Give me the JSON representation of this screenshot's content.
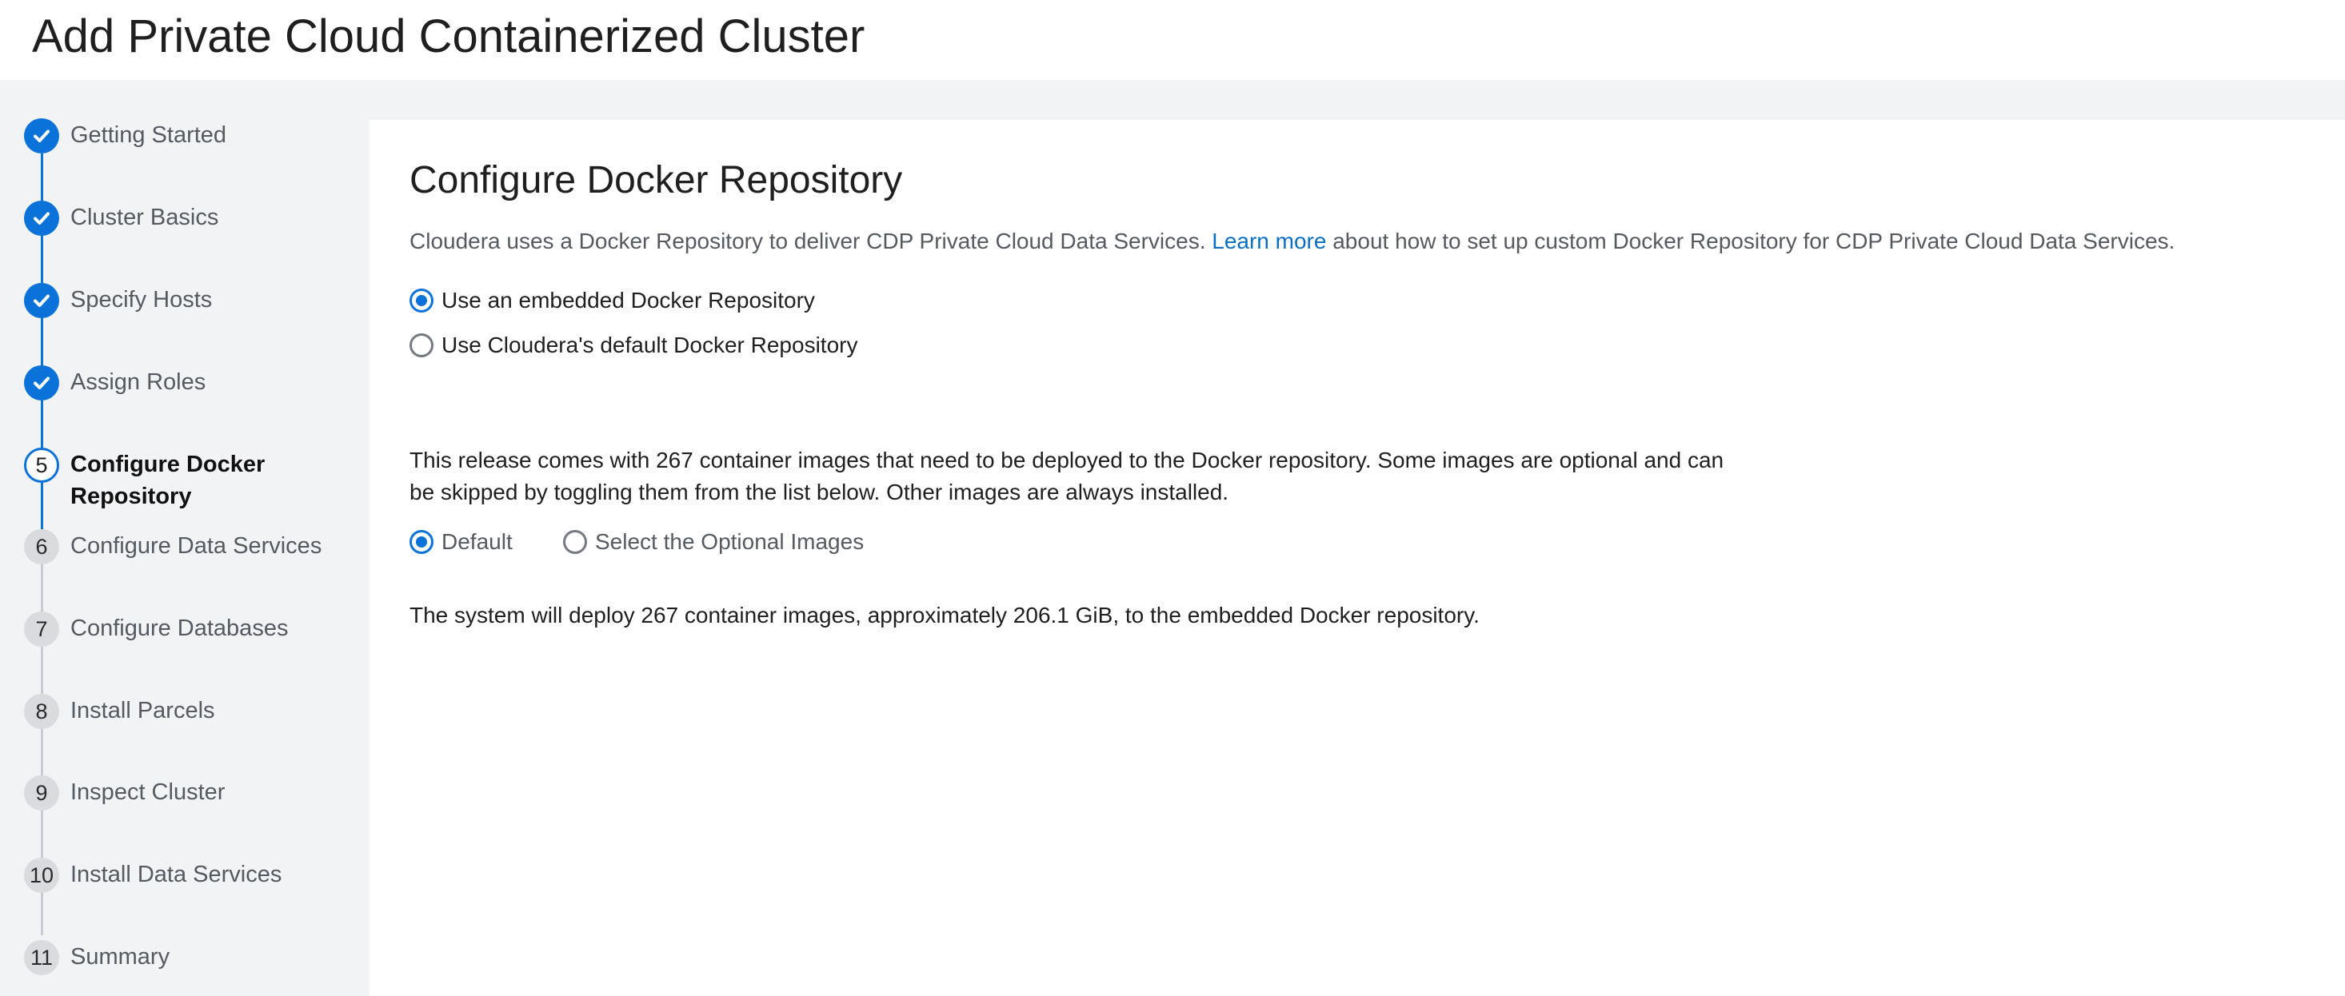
{
  "header": {
    "title": "Add Private Cloud Containerized Cluster"
  },
  "steps": [
    {
      "num": "",
      "label": "Getting Started",
      "state": "done"
    },
    {
      "num": "",
      "label": "Cluster Basics",
      "state": "done"
    },
    {
      "num": "",
      "label": "Specify Hosts",
      "state": "done"
    },
    {
      "num": "",
      "label": "Assign Roles",
      "state": "done"
    },
    {
      "num": "5",
      "label": "Configure Docker Repository",
      "state": "current"
    },
    {
      "num": "6",
      "label": "Configure Data Services",
      "state": "todo"
    },
    {
      "num": "7",
      "label": "Configure Databases",
      "state": "todo"
    },
    {
      "num": "8",
      "label": "Install Parcels",
      "state": "todo"
    },
    {
      "num": "9",
      "label": "Inspect Cluster",
      "state": "todo"
    },
    {
      "num": "10",
      "label": "Install Data Services",
      "state": "todo"
    },
    {
      "num": "11",
      "label": "Summary",
      "state": "todo"
    }
  ],
  "main": {
    "title": "Configure Docker Repository",
    "intro_before": "Cloudera uses a Docker Repository to deliver CDP Private Cloud Data Services. ",
    "intro_link": "Learn more",
    "intro_after": " about how to set up custom Docker Repository for CDP Private Cloud Data Services.",
    "repo_options": [
      {
        "label": "Use an embedded Docker Repository",
        "checked": true
      },
      {
        "label": "Use Cloudera's default Docker Repository",
        "checked": false
      }
    ],
    "release_text": "This release comes with 267 container images that need to be deployed to the Docker repository. Some images are optional and can be skipped by toggling them from the list below. Other images are always installed.",
    "image_options": [
      {
        "label": "Default",
        "checked": true
      },
      {
        "label": "Select the Optional Images",
        "checked": false
      }
    ],
    "deploy_text": "The system will deploy 267 container images, approximately 206.1 GiB, to the embedded Docker repository."
  },
  "colors": {
    "accent": "#0a72d8",
    "link": "#0a6fc2",
    "sidebar_bg": "#f2f3f5"
  }
}
